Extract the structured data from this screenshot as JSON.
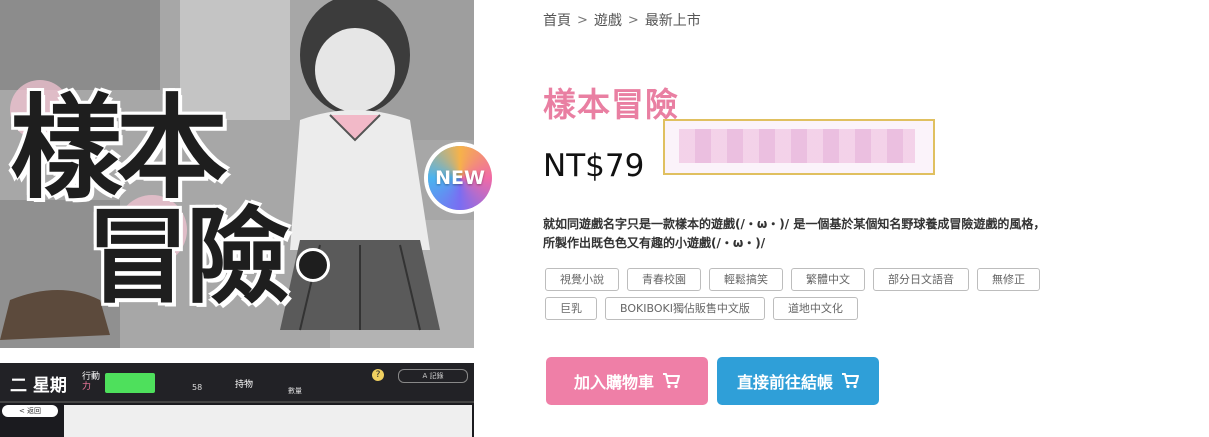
{
  "cover": {
    "art_title_line1": "樣本",
    "art_title_line2": "冒險",
    "badge": "NEW"
  },
  "game_screenshot": {
    "day": "二 星期",
    "action_label": "行動",
    "power_label": "力",
    "value": "58",
    "item_label": "持物",
    "cell_label": "數量",
    "help": "?",
    "pill": "A    記錄",
    "back": "< 返回"
  },
  "breadcrumb": {
    "items": [
      "首頁",
      "遊戲",
      "最新上市"
    ],
    "separator": ">"
  },
  "product": {
    "title": "樣本冒險",
    "price": "NT$79",
    "description": "就如同遊戲名字只是一款樣本的遊戲(/・ω・)/ 是一個基於某個知名野球養成冒險遊戲的風格，所製作出既色色又有趣的小遊戲(/・ω・)/",
    "tags": [
      "視覺小說",
      "青春校園",
      "輕鬆搞笑",
      "繁體中文",
      "部分日文語音",
      "無修正",
      "巨乳",
      "BOKIBOKI獨佔販售中文版",
      "道地中文化"
    ]
  },
  "buttons": {
    "add_to_cart": "加入購物車",
    "checkout": "直接前往結帳"
  },
  "colors": {
    "title_pink": "#e97fa2",
    "cart_button": "#ef7fa7",
    "checkout_button": "#2f9fd8"
  },
  "icons": [
    "cart-icon",
    "chevron-right-icon"
  ]
}
